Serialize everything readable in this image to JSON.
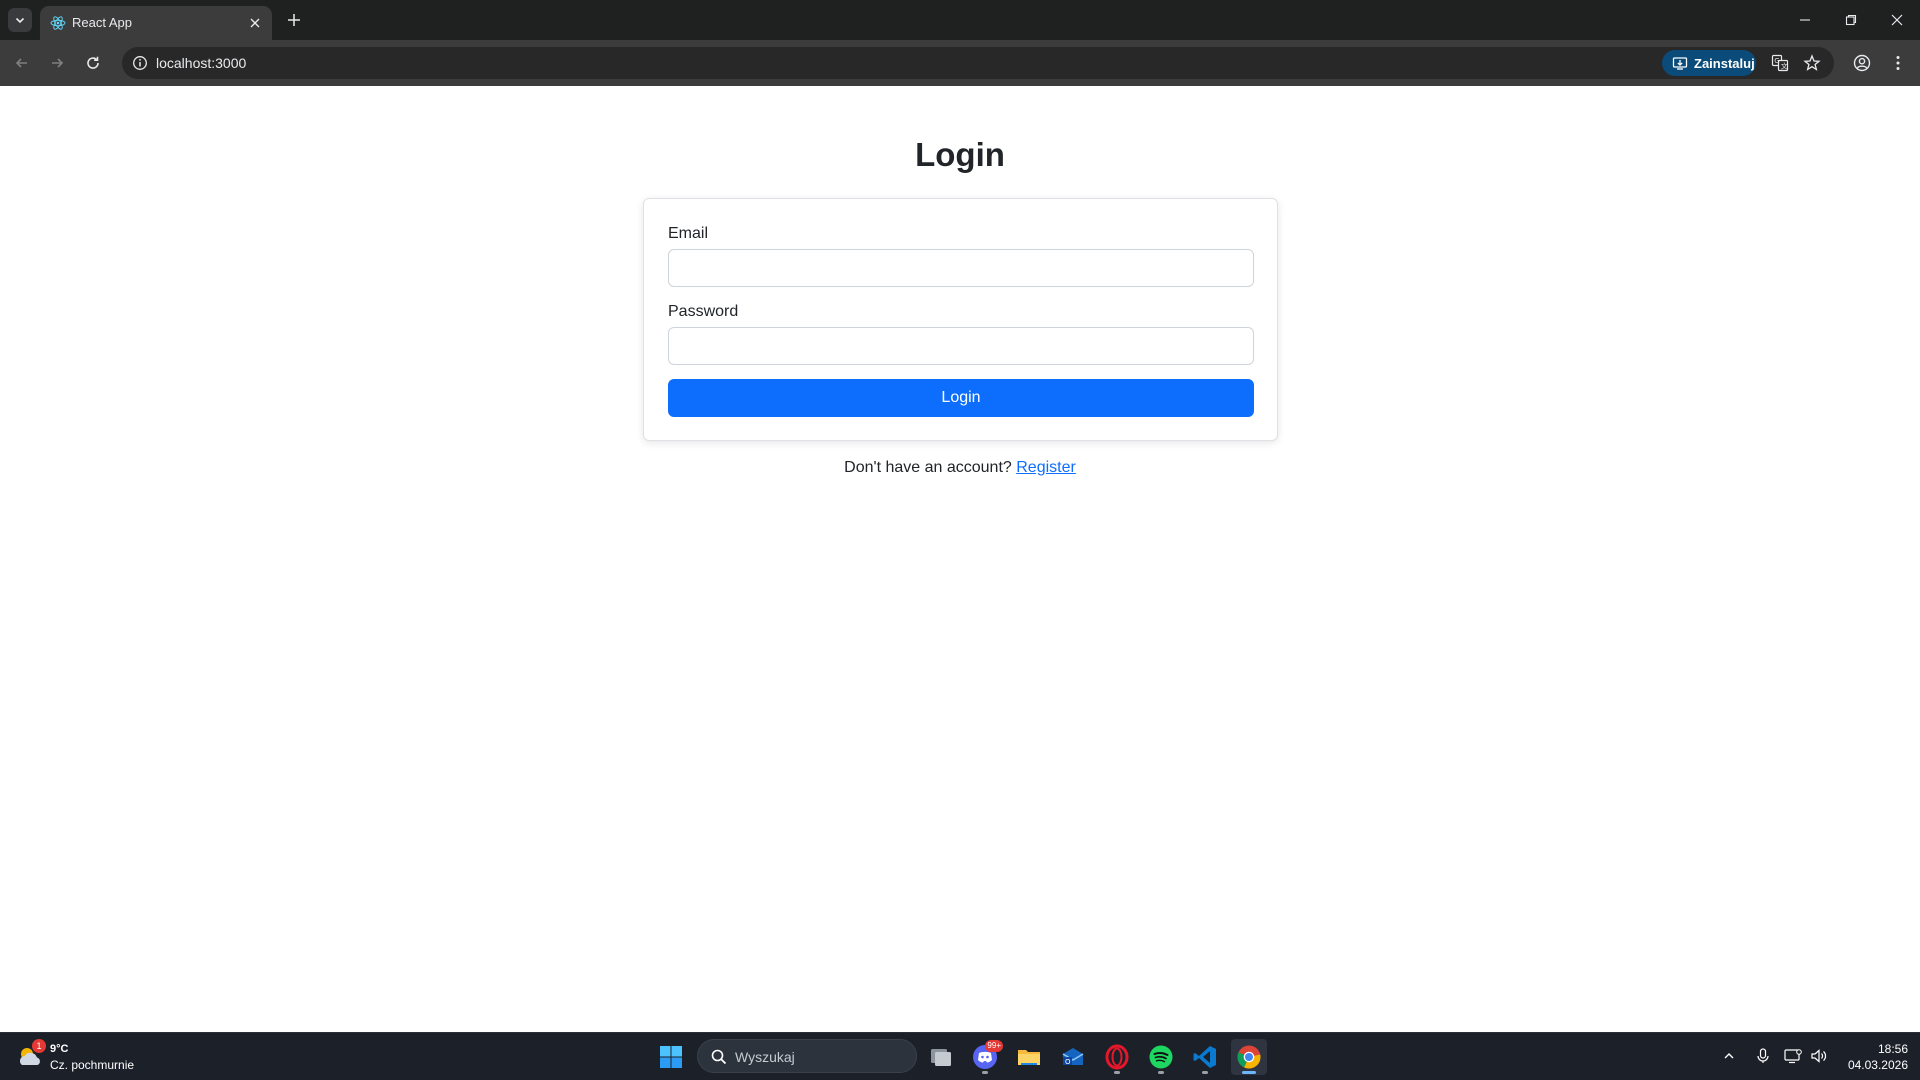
{
  "browser": {
    "tab_title": "React App",
    "url": "localhost:3000",
    "install_label": "Zainstaluj",
    "icons": {
      "tab_list": "chevron-down-icon",
      "favicon": "react-logo-icon",
      "tab_close": "close-icon",
      "new_tab": "plus-icon",
      "minimize": "minimize-icon",
      "restore": "restore-icon",
      "close_window": "close-icon",
      "back": "arrow-left-icon",
      "forward": "arrow-right-icon",
      "reload": "reload-icon",
      "site_info": "info-icon",
      "install": "install-app-icon",
      "translate": "translate-icon",
      "bookmark": "star-icon",
      "profile": "profile-icon",
      "menu": "more-vertical-icon"
    }
  },
  "page": {
    "title": "Login",
    "form": {
      "email_label": "Email",
      "email_value": "",
      "password_label": "Password",
      "password_value": "",
      "submit_label": "Login"
    },
    "register_prompt": "Don't have an account?",
    "register_link": "Register"
  },
  "taskbar": {
    "weather_temp": "9°C",
    "weather_desc": "Cz. pochmurnie",
    "weather_badge": "1",
    "search_placeholder": "Wyszukaj",
    "discord_badge": "99+",
    "clock_time": "18:56",
    "clock_date": "04.03.2026",
    "apps": [
      "task-view",
      "discord",
      "file-explorer",
      "mail",
      "opera",
      "spotify",
      "vscode",
      "chrome"
    ]
  },
  "colors": {
    "primary": "#0d6efd",
    "text": "#212529",
    "border": "#dee2e6",
    "chrome_dark": "#1f2020",
    "toolbar": "#3c3c3c",
    "taskbar": "#1c2129"
  }
}
